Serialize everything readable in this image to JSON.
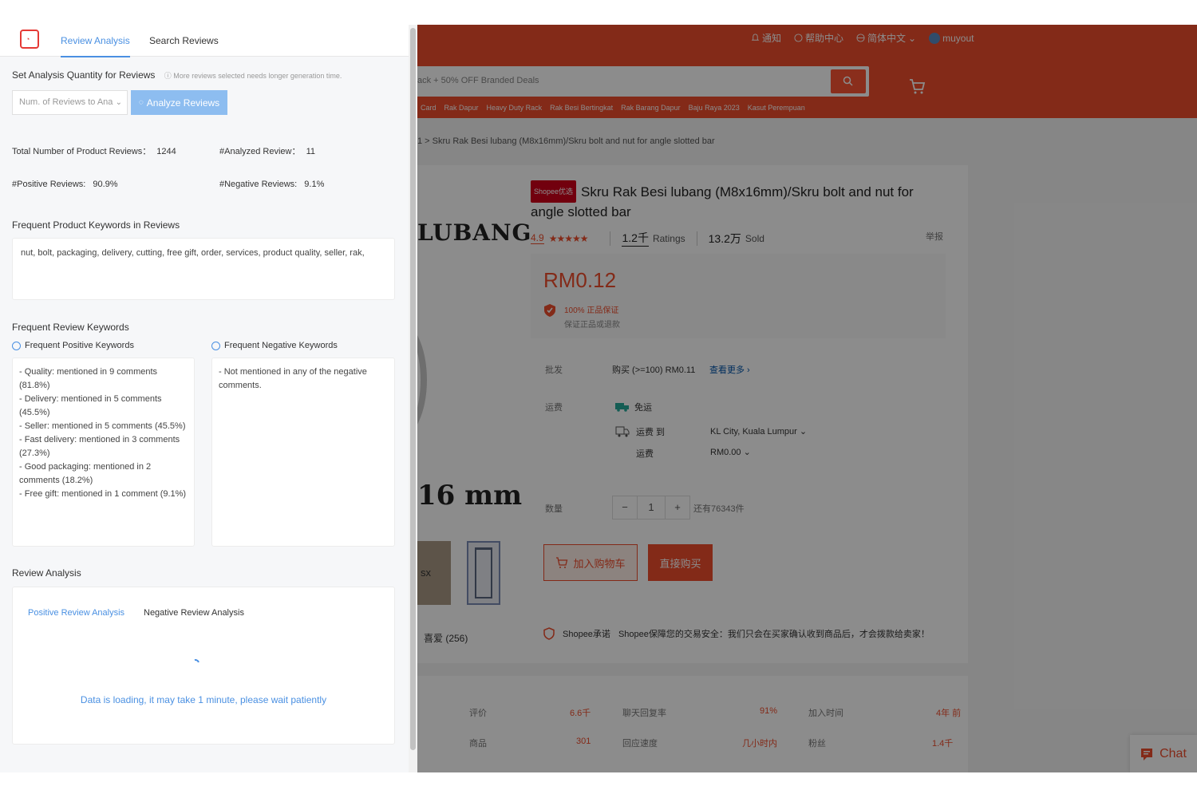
{
  "panel": {
    "tabs": [
      "Review Analysis",
      "Search Reviews"
    ],
    "quantity_label": "Set Analysis Quantity for Reviews",
    "quantity_hint": "More reviews selected needs longer generation time.",
    "select_placeholder": "Num. of Reviews to Ana",
    "analyze_button": "Analyze Reviews",
    "total_reviews_label": "Total Number of Product Reviews：",
    "total_reviews_value": "1244",
    "analyzed_label": "#Analyzed Review：",
    "analyzed_value": "11",
    "positive_label": "#Positive Reviews:",
    "positive_value": "90.9%",
    "negative_label": "#Negative Reviews:",
    "negative_value": "9.1%",
    "product_keywords_title": "Frequent Product Keywords in Reviews",
    "product_keywords": "nut, bolt, packaging, delivery, cutting, free gift, order, services, product quality, seller, rak,",
    "review_keywords_title": "Frequent Review Keywords",
    "positive_keywords_title": "Frequent Positive Keywords",
    "negative_keywords_title": "Frequent Negative Keywords",
    "positive_keywords": [
      "- Quality: mentioned in 9 comments (81.8%)",
      "- Delivery: mentioned in 5 comments (45.5%)",
      "- Seller: mentioned in 5 comments (45.5%)",
      "- Fast delivery: mentioned in 3 comments (27.3%)",
      "- Good packaging: mentioned in 2 comments (18.2%)",
      "- Free gift: mentioned in 1 comment (9.1%)"
    ],
    "negative_keywords": "- Not mentioned in any of the negative comments.",
    "review_analysis_title": "Review Analysis",
    "review_tabs": [
      "Positive Review Analysis",
      "Negative Review Analysis"
    ],
    "loading_text": "Data is loading, it may take 1 minute, please wait patiently"
  },
  "shop": {
    "topnav": [
      "通知",
      "帮助中心",
      "简体中文",
      "muyout"
    ],
    "search_placeholder": "ack + 50% OFF Branded Deals",
    "categories": [
      "Card",
      "Rak Dapur",
      "Heavy Duty Rack",
      "Rak Besi Bertingkat",
      "Rak Barang Dapur",
      "Baju Raya 2023",
      "Kasut Perempuan"
    ],
    "breadcrumb": "1 > Skru Rak Besi lubang (M8x16mm)/Skru bolt and nut for angle slotted bar",
    "image_text_1": "LUBANG",
    "image_text_2": "16 mm",
    "thumb_text": "sx",
    "favorites": "喜爱 (256)",
    "mall_badge": "Shopee优选",
    "title": "Skru Rak Besi lubang (M8x16mm)/Skru bolt and nut for angle slotted bar",
    "rating": "4.9",
    "stars": "★★★★★",
    "ratings_count": "1.2千",
    "ratings_label": "Ratings",
    "sold_count": "13.2万",
    "sold_label": "Sold",
    "report": "举报",
    "price": "RM0.12",
    "guarantee_1": "100% 正品保证",
    "guarantee_2": "保证正品或退款",
    "wholesale_label": "批发",
    "wholesale_value": "购买 (>=100) RM0.11",
    "wholesale_link": "查看更多 ›",
    "shipping_label": "运费",
    "free_ship": "免运",
    "ship_to_label": "运费 到",
    "ship_to_value": "KL City, Kuala Lumpur ⌄",
    "ship_fee_label": "运费",
    "ship_fee_value": "RM0.00 ⌄",
    "qty_label": "数量",
    "qty_minus": "−",
    "qty_value": "1",
    "qty_plus": "+",
    "stock": "还有76343件",
    "add_cart": "加入购物车",
    "buy_now": "直接购买",
    "guarantee_brand": "Shopee承诺",
    "guarantee_text": "Shopee保障您的交易安全：我们只会在买家确认收到商品后，才会拨款给卖家！",
    "stats": [
      {
        "k": "评价",
        "v": "6.6千"
      },
      {
        "k": "聊天回复率",
        "v": "91%"
      },
      {
        "k": "加入时间",
        "v": "4年 前"
      },
      {
        "k": "商品",
        "v": "301"
      },
      {
        "k": "回应速度",
        "v": "几小时内"
      },
      {
        "k": "粉丝",
        "v": "1.4千"
      }
    ],
    "chat": "Chat"
  },
  "colors": {
    "accent": "#4a90e2",
    "shopee": "#ee4d2d"
  }
}
